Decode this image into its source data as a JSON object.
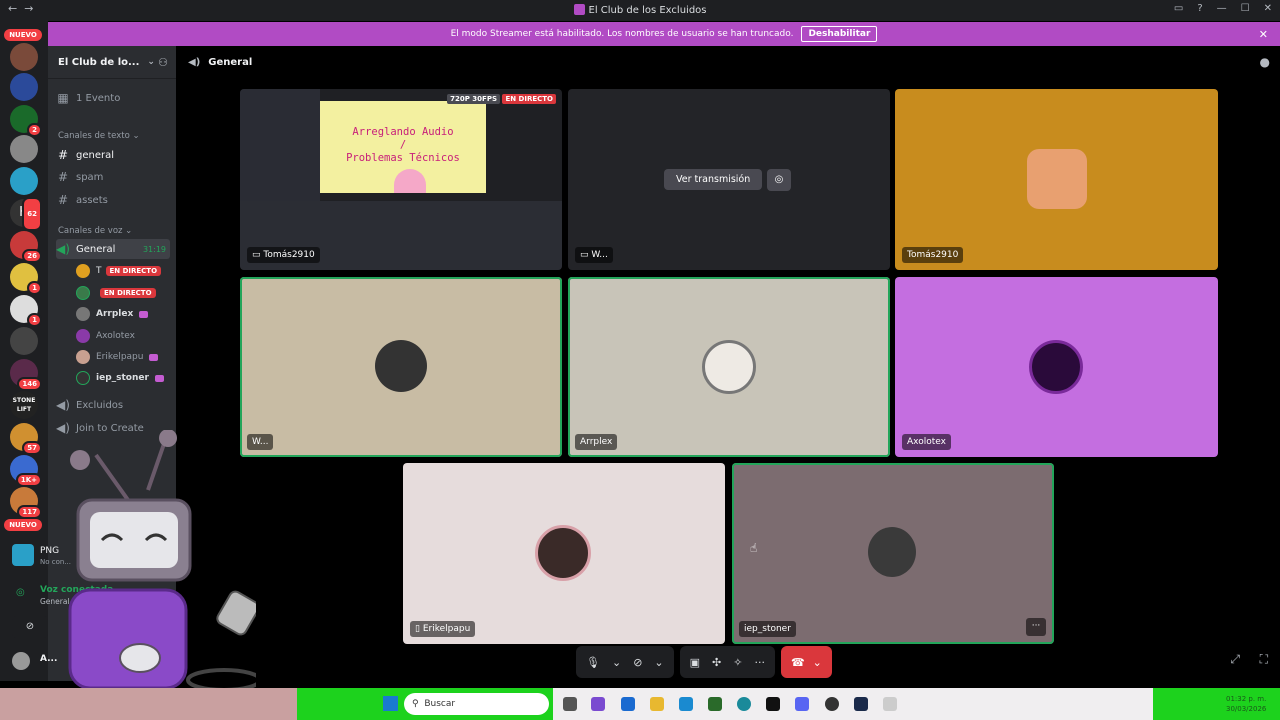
{
  "window": {
    "title": "El Club de los Excluidos",
    "back": "←",
    "forward": "→"
  },
  "banner": {
    "text": "El modo Streamer está habilitado. Los nombres de usuario se han truncado.",
    "button": "Deshabilitar",
    "close": "✕"
  },
  "guilds": {
    "new_top": "NUEVO",
    "new_bottom": "NUEVO",
    "stone": "STONE LIFT",
    "badges": [
      "2",
      "62",
      "26",
      "1",
      "1",
      "146",
      "57",
      "1K+",
      "117"
    ]
  },
  "sidebar": {
    "server_name": "El Club de lo...",
    "events": "1 Evento",
    "text_category": "Canales de texto",
    "text_channels": [
      "general",
      "spam",
      "assets"
    ],
    "voice_category": "Canales de voz",
    "voice_channel": "General",
    "voice_time": "31:19",
    "members": [
      {
        "name": "T",
        "live": "EN DIRECTO",
        "color": "#e0a020"
      },
      {
        "name": "",
        "live": "EN DIRECTO",
        "color": "#3a7a4a"
      },
      {
        "name": "Arrplex",
        "live": "",
        "color": "#777"
      },
      {
        "name": "Axolotex",
        "live": "",
        "color": "#8a3aa8"
      },
      {
        "name": "Erikelpapu",
        "live": "",
        "color": "#c8a090"
      },
      {
        "name": "iep_stoner",
        "live": "",
        "color": "#333"
      }
    ],
    "other_channels": [
      "Excluidos",
      "Join to Create"
    ]
  },
  "user_panel": {
    "app": "PNG",
    "app_sub": "No con...",
    "voice_status": "Voz conectada",
    "voice_location": "General / El Club",
    "username": "A..."
  },
  "channel_header": {
    "name": "General"
  },
  "tiles": [
    {
      "label": "Tomás2910",
      "quality": "720P 30FPS",
      "live": "EN DIRECTO",
      "slide_line1": "Arreglando Audio",
      "slide_line2": "/",
      "slide_line3": "Problemas Técnicos"
    },
    {
      "label": "W...",
      "watch": "Ver transmisión"
    },
    {
      "label": "Tomás2910",
      "bg": "#c88c1e"
    },
    {
      "label": "W...",
      "bg": "#c8bca4"
    },
    {
      "label": "Arrplex",
      "bg": "#c8c4b8"
    },
    {
      "label": "Axolotex",
      "bg": "#c46ee0"
    },
    {
      "label": "Erikelpapu",
      "bg": "#e6dcdc"
    },
    {
      "label": "iep_stoner",
      "bg": "#7c6c70"
    }
  ],
  "taskbar": {
    "search": "Buscar",
    "time": "01:32 p. m.",
    "date": "30/03/2026"
  }
}
